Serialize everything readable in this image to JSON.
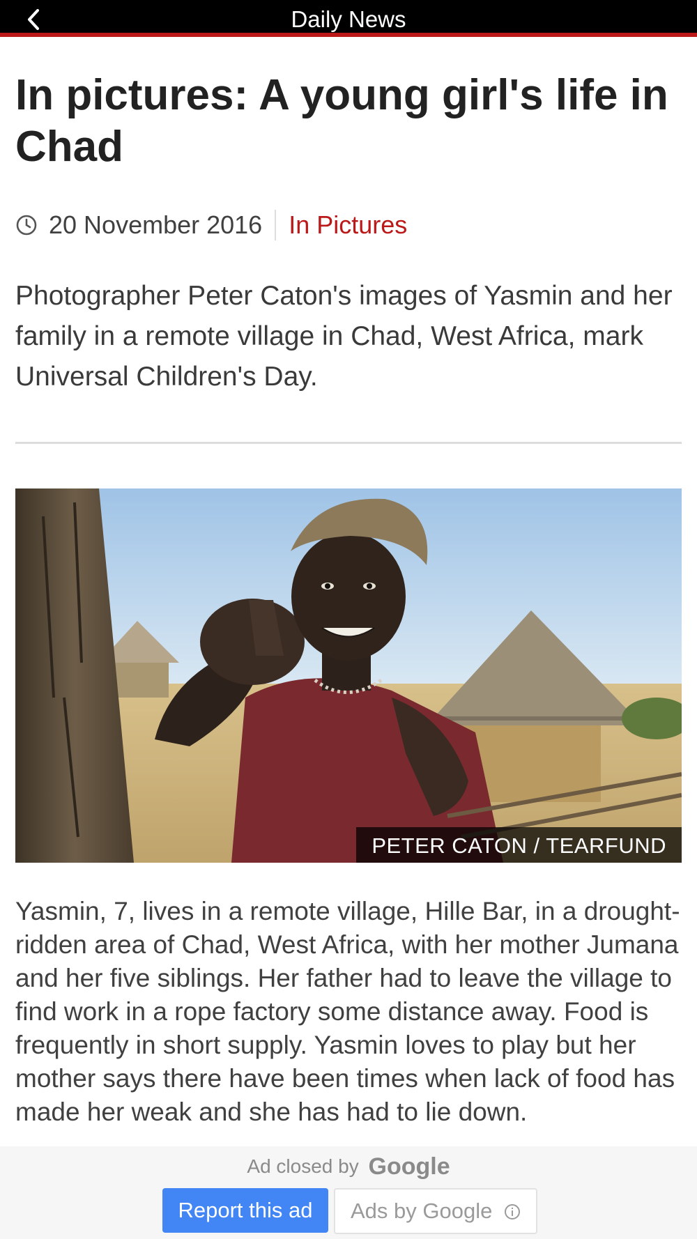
{
  "header": {
    "title": "Daily News",
    "back_icon": "chevron-left-icon",
    "accent_color": "#bb1919"
  },
  "article": {
    "headline": "In pictures: A young girl's life in Chad",
    "date": "20 November 2016",
    "date_icon": "clock-icon",
    "section": "In Pictures",
    "intro": "Photographer Peter Caton's images of Yasmin and her family in a remote village in Chad, West Africa, mark Universal Children's Day.",
    "image_credit": "PETER CATON / TEARFUND",
    "body": "Yasmin, 7, lives in a remote village, Hille Bar, in a drought-ridden area of Chad, West Africa, with her mother Jumana and her five siblings. Her father had to leave the village to find work in a rope factory some distance away. Food is frequently in short supply. Yasmin loves to play but her mother says there have been times when lack of food has made her weak and she has had to lie down."
  },
  "ad": {
    "closed_text": "Ad closed by",
    "brand": "Google",
    "report_label": "Report this ad",
    "ads_by_label": "Ads by Google",
    "info_icon": "info-icon",
    "button_color": "#4285f4"
  }
}
